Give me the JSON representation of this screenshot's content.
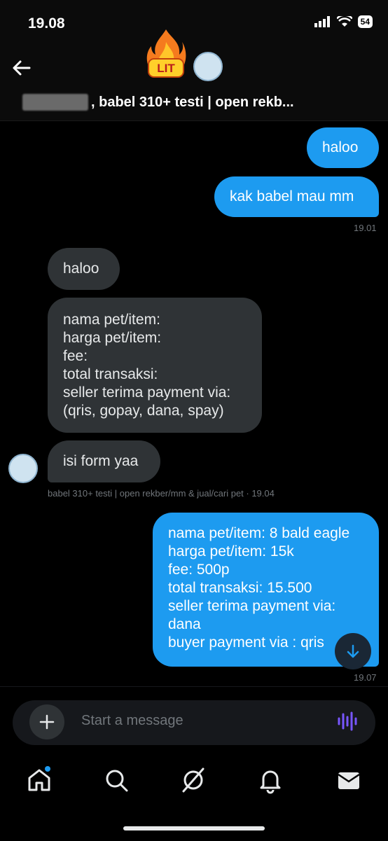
{
  "status": {
    "time": "19.08",
    "battery": "54"
  },
  "header": {
    "name_suffix": ", babel 310+ testi | open rekb...",
    "lit_label": "LIT",
    "back_icon": "arrow-left-icon"
  },
  "messages": [
    {
      "dir": "out",
      "text": "haloo"
    },
    {
      "dir": "out",
      "text": "kak babel mau mm"
    },
    {
      "dir": "in",
      "text": "haloo"
    },
    {
      "dir": "in",
      "lines": [
        "nama pet/item:",
        "harga pet/item:",
        "fee:",
        "total transaksi:",
        "seller terima payment via:",
        "(qris, gopay, dana, spay)"
      ]
    },
    {
      "dir": "in",
      "text": "isi form yaa"
    },
    {
      "dir": "out",
      "lines": [
        "nama pet/item: 8 bald eagle",
        "harga pet/item: 15k",
        "fee: 500p",
        "total transaksi: 15.500",
        "seller terima payment via:",
        "dana",
        "buyer payment via : qris"
      ]
    }
  ],
  "timestamps": {
    "t1": "19.01",
    "t2": "babel 310+ testi | open rekber/mm & jual/cari pet · 19.04",
    "t3": "19.07"
  },
  "composer": {
    "placeholder": "Start a message"
  },
  "nav": [
    "home-icon",
    "search-icon",
    "grok-icon",
    "notifications-icon",
    "messages-icon"
  ],
  "colors": {
    "accent": "#1d9bf0",
    "incoming": "#2f3336",
    "background": "#000000",
    "voice": "#7856ff"
  }
}
